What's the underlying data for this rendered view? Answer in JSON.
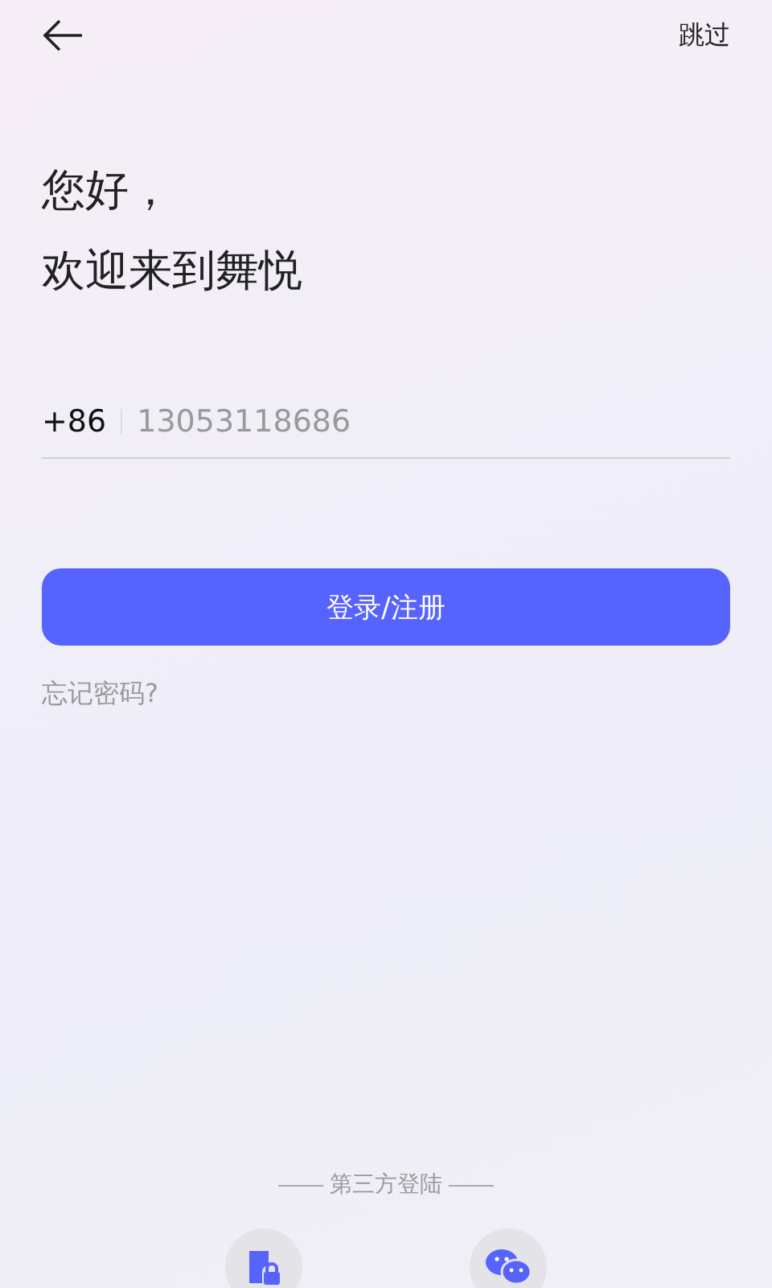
{
  "top_bar": {
    "skip": "跳过"
  },
  "greeting": [
    "您好，",
    "欢迎来到舞悦"
  ],
  "phone": {
    "country_code": "+86",
    "value": "13053118686"
  },
  "login_button": "登录/注册",
  "forgot_password": "忘记密码?",
  "third_party": {
    "label": "第三方登陆",
    "options": [
      {
        "kind": "phone-lock"
      },
      {
        "kind": "wechat"
      }
    ]
  }
}
